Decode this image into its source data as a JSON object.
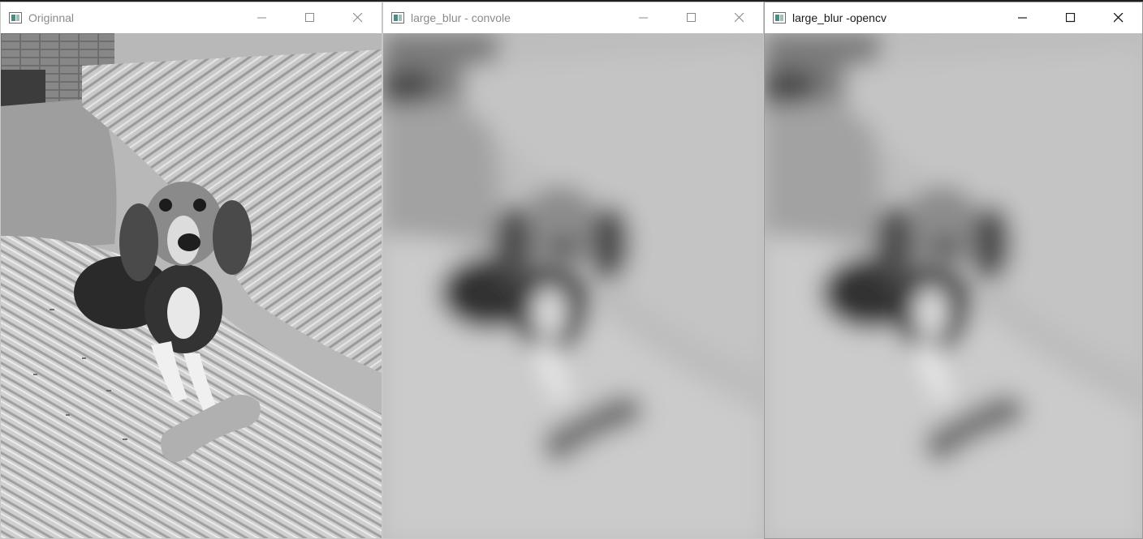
{
  "windows": [
    {
      "id": "original",
      "title": "Originnal",
      "image": "grayscale photo of a beagle dog lying on a textured blanket on a couch",
      "blur": false,
      "active": false
    },
    {
      "id": "convolve",
      "title": "large_blur - convole",
      "image": "heavily blurred grayscale photo of the beagle on the couch",
      "blur": true,
      "active": false
    },
    {
      "id": "opencv",
      "title": "large_blur -opencv",
      "image": "heavily blurred grayscale photo of the beagle on the couch",
      "blur": true,
      "active": true
    }
  ],
  "controls": {
    "minimize_icon": "minimize-icon",
    "maximize_icon": "maximize-icon",
    "close_icon": "close-icon"
  },
  "colors": {
    "title_inactive": "#8a8a8a",
    "title_active": "#1a1a1a",
    "icon_accent": "#4a8c84"
  }
}
